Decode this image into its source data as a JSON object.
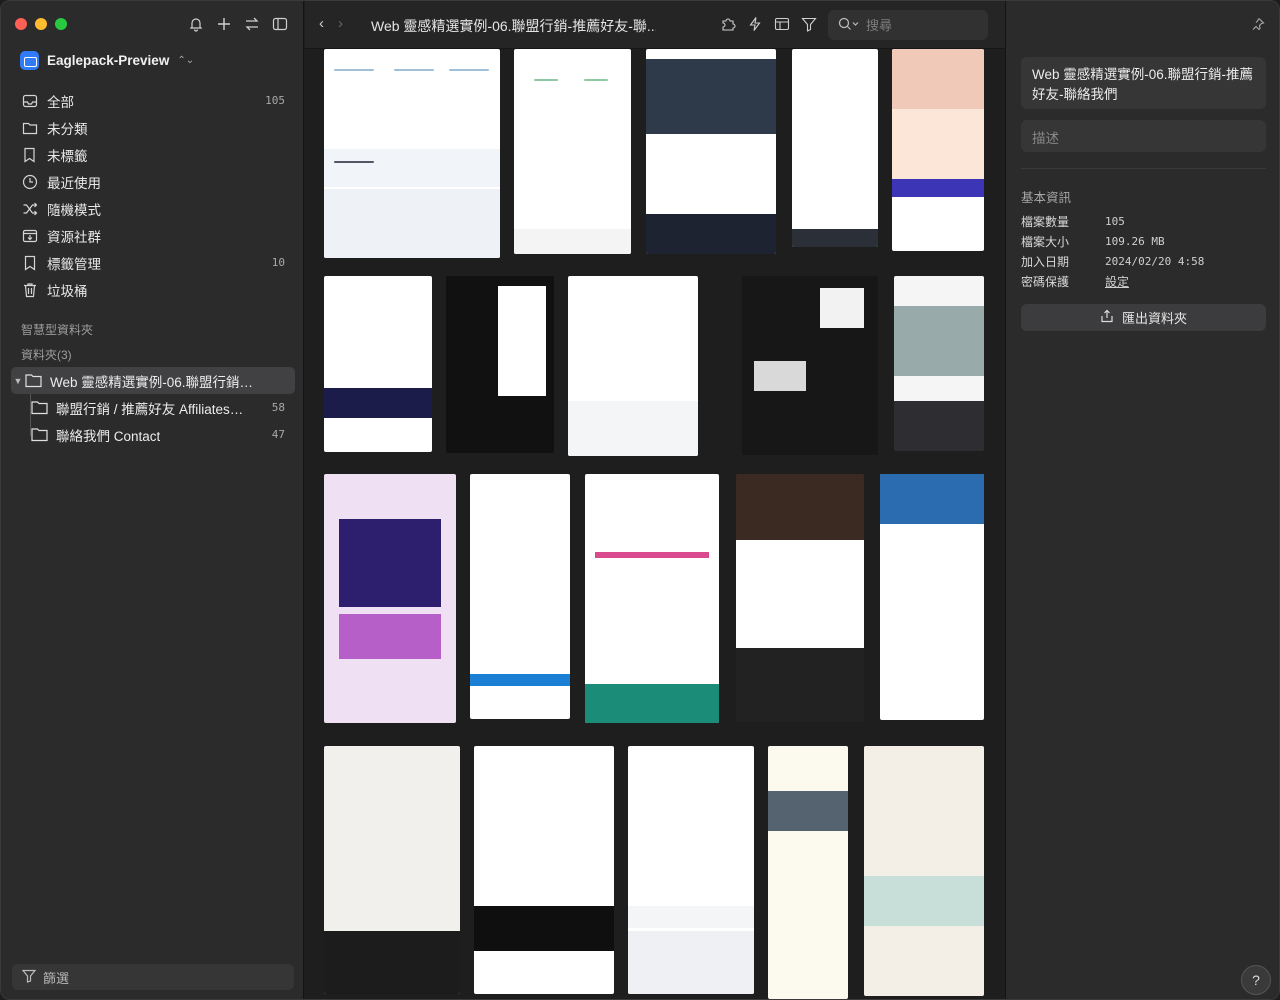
{
  "sidebar": {
    "library_name": "Eaglepack-Preview",
    "items": [
      {
        "label": "全部",
        "count": "105",
        "icon": "inbox-icon"
      },
      {
        "label": "未分類",
        "count": "",
        "icon": "folder-question-icon"
      },
      {
        "label": "未標籤",
        "count": "",
        "icon": "tag-off-icon"
      },
      {
        "label": "最近使用",
        "count": "",
        "icon": "clock-icon"
      },
      {
        "label": "隨機模式",
        "count": "",
        "icon": "shuffle-icon"
      },
      {
        "label": "資源社群",
        "count": "",
        "icon": "download-box-icon"
      },
      {
        "label": "標籤管理",
        "count": "10",
        "icon": "bookmark-icon"
      },
      {
        "label": "垃圾桶",
        "count": "",
        "icon": "trash-icon"
      }
    ],
    "smart_folders_label": "智慧型資料夾",
    "folders_label": "資料夾(3)",
    "folders": [
      {
        "name": "Web 靈感精選實例-06.聯盟行銷-...",
        "count": ""
      },
      {
        "name": "聯盟行銷 / 推薦好友 Affiliates /...",
        "count": "58"
      },
      {
        "name": "聯絡我們 Contact",
        "count": "47"
      }
    ],
    "filter_label": "篩選"
  },
  "toolbar": {
    "back": "‹",
    "forward": "›",
    "title": "Web 靈感精選實例-06.聯盟行銷-推薦好友-聯...",
    "search_placeholder": "搜尋"
  },
  "panel": {
    "title": "Web 靈感精選實例-06.聯盟行銷-推薦好友-聯絡我們",
    "description_placeholder": "描述",
    "info_heading": "基本資訊",
    "info": [
      {
        "key": "檔案數量",
        "value": "105"
      },
      {
        "key": "檔案大小",
        "value": "109.26 MB"
      },
      {
        "key": "加入日期",
        "value": "2024/02/20 4:58"
      },
      {
        "key": "密碼保護",
        "value": "設定"
      }
    ],
    "export_label": "匯出資料夾"
  },
  "help_label": "?",
  "colors": {
    "accent": "#2f7cf6",
    "sidebar_bg": "#2b2b2c",
    "selected_bg": "#414143"
  }
}
